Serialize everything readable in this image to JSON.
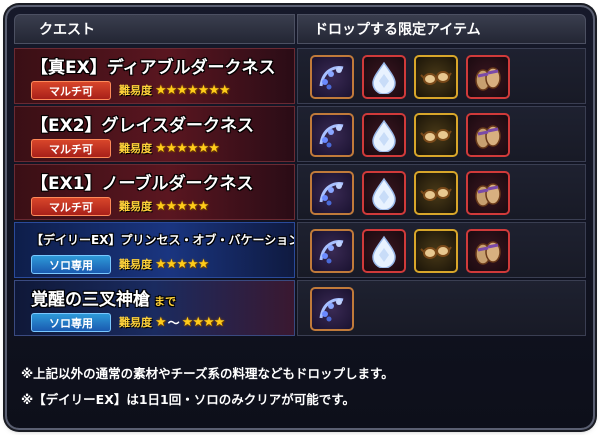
{
  "header": {
    "quest_col": "クエスト",
    "drops_col": "ドロップする限定アイテム"
  },
  "difficulty_label": "難易度",
  "rows": [
    {
      "title": "【真EX】ディアブルダークネス",
      "mode": "マルチ可",
      "stars": "★★★★★★★",
      "items": [
        "chain",
        "gem",
        "glasses",
        "sandals"
      ]
    },
    {
      "title": "【EX2】グレイスダークネス",
      "mode": "マルチ可",
      "stars": "★★★★★★",
      "items": [
        "chain",
        "gem",
        "glasses",
        "sandals"
      ]
    },
    {
      "title": "【EX1】ノーブルダークネス",
      "mode": "マルチ可",
      "stars": "★★★★★",
      "items": [
        "chain",
        "gem",
        "glasses",
        "sandals"
      ]
    },
    {
      "title": "【デイリーEX】プリンセス・オブ・バケーション",
      "mode": "ソロ専用",
      "stars": "★★★★★",
      "items": [
        "chain",
        "gem",
        "glasses",
        "sandals"
      ]
    },
    {
      "title": "覚醒の三叉神槍",
      "title_suffix": "まで",
      "mode": "ソロ専用",
      "stars_min": "★",
      "stars_sep": "〜",
      "stars_max": "★★★★",
      "items": [
        "chain"
      ]
    }
  ],
  "notes": [
    "※上記以外の通常の素材やチーズ系の料理などもドロップします。",
    "※【デイリーEX】は1日1回・ソロのみクリアが可能です。"
  ],
  "colors": {
    "accent_gold": "#ffd23a",
    "multi_badge": "#d8462a",
    "solo_badge": "#2e9ad8"
  },
  "icons": [
    "chain-of-pendants-icon",
    "water-drop-gem-icon",
    "sunglasses-icon",
    "sandals-icon"
  ]
}
